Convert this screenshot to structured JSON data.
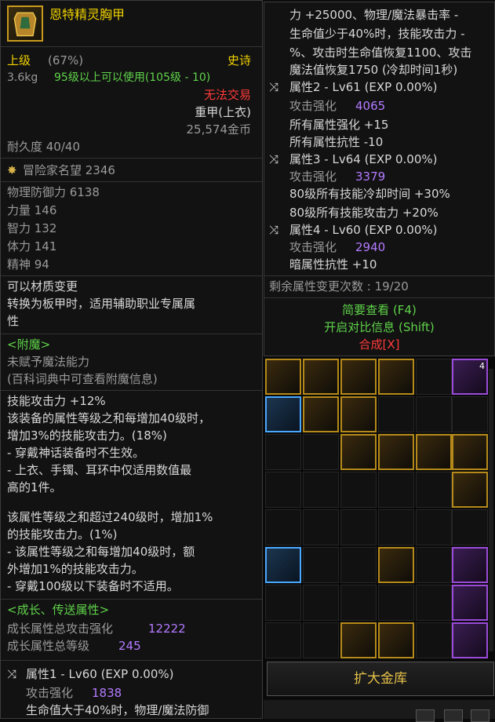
{
  "item": {
    "name": "恩特精灵胸甲",
    "grade": "上级",
    "grade_pct": "(67%)",
    "rarity": "史诗",
    "weight": "3.6kg",
    "level_req": "95级以上可以使用(105级 - 10)",
    "trade": "无法交易",
    "type": "重甲(上衣)",
    "price": "25,574金币",
    "durability": "耐久度 40/40",
    "adventure": "冒险家名望 2346",
    "stats": [
      "物理防御力 6138",
      "力量 146",
      "智力 132",
      "体力 141",
      "精神 94"
    ],
    "material_change": [
      "可以材质变更",
      "转换为板甲时，适用辅助职业专属属",
      "性"
    ],
    "enchant_title": "<附魔>",
    "enchant_lines": [
      "未赋予魔法能力",
      "(百科词典中可查看附魔信息)"
    ],
    "skill_lines": [
      "技能攻击力 +12%",
      "该装备的属性等级之和每增加40级时，",
      "增加3%的技能攻击力。(18%)",
      "- 穿戴神话装备时不生效。",
      "- 上衣、手镯、耳环中仅适用数值最",
      "高的1件。",
      "该属性等级之和超过240级时，增加1%",
      "的技能攻击力。(1%)",
      "- 该属性等级之和每增加40级时，额",
      "外增加1%的技能攻击力。",
      "- 穿戴100级以下装备时不适用。"
    ],
    "growth_title": "<成长、传送属性>",
    "growth_total_label": "成长属性总攻击强化",
    "growth_total_value": "12222",
    "growth_level_label": "成长属性总等级",
    "growth_level_value": "245",
    "attr1_title": "属性1 - Lv60 (EXP 0.00%)",
    "attr1_atk_label": "攻击强化",
    "attr1_atk_value": "1838",
    "attr1_desc": "生命值大于40%时，物理/魔法防御"
  },
  "compare": {
    "top_lines": [
      "力 +25000、物理/魔法暴击率 -",
      "生命值少于40%时，技能攻击力 -",
      "%、攻击时生命值恢复1100、攻击",
      "魔法值恢复1750 (冷却时间1秒)"
    ],
    "attr2_title": "属性2 - Lv61 (EXP 0.00%)",
    "attr2_atk_label": "攻击强化",
    "attr2_atk_value": "4065",
    "attr2_extra": [
      "所有属性强化 +15",
      "所有属性抗性 -10"
    ],
    "attr3_title": "属性3 - Lv64 (EXP 0.00%)",
    "attr3_atk_label": "攻击强化",
    "attr3_atk_value": "3379",
    "attr3_extra": [
      "80级所有技能冷却时间 +30%",
      "80级所有技能攻击力 +20%"
    ],
    "attr4_title": "属性4 - Lv60 (EXP 0.00%)",
    "attr4_atk_label": "攻击强化",
    "attr4_atk_value": "2940",
    "attr4_extra": [
      "暗属性抗性 +10"
    ],
    "remaining": "剩余属性变更次数 : 19/20",
    "brief": "简要查看 (F4)",
    "open_compare": "开启对比信息 (Shift)",
    "synth": "合成[X]"
  },
  "inventory": {
    "expand_label": "扩大金库",
    "badge_count": "4"
  }
}
